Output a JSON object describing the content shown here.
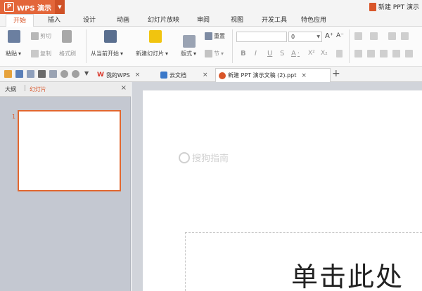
{
  "app": {
    "name": "WPS 演示",
    "window_title": "新建 PPT 演示"
  },
  "menu": [
    "开始",
    "插入",
    "设计",
    "动画",
    "幻灯片放映",
    "审阅",
    "视图",
    "开发工具",
    "特色应用"
  ],
  "ribbon": {
    "paste": "粘贴",
    "cut": "剪切",
    "copy": "复制",
    "format_painter": "格式刷",
    "from_current": "从当前开始",
    "new_slide": "新建幻灯片",
    "layout": "版式",
    "reset": "重置",
    "section": "节",
    "font_size": "0",
    "bold": "B",
    "italic": "I",
    "underline": "U",
    "strike": "S",
    "font_color": "A",
    "superscript": "X²",
    "subscript": "X₂",
    "grow_font": "A⁺",
    "shrink_font": "A⁻"
  },
  "tabs": [
    {
      "label": "我的WPS"
    },
    {
      "label": "云文档"
    },
    {
      "label": "新建 PPT 演示文稿 (2).ppt"
    }
  ],
  "panel": {
    "outline": "大纲",
    "slides": "幻灯片",
    "slide_number": "1"
  },
  "slide": {
    "placeholder": "单击此处"
  },
  "watermark": "搜狗指南",
  "colors": {
    "accent": "#e3663a",
    "selection": "#e2672f"
  }
}
